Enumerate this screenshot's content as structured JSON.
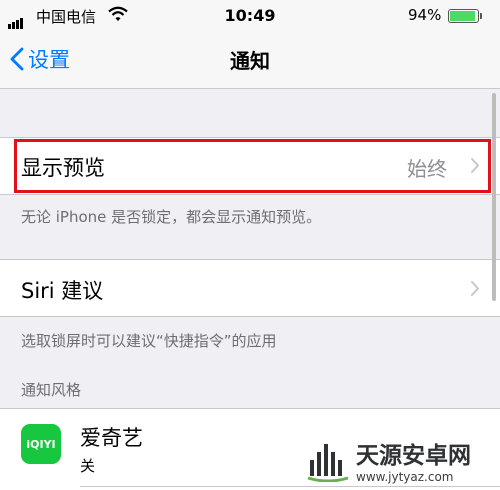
{
  "status_bar": {
    "carrier": "中国电信",
    "time": "10:49",
    "battery_percent": "94%",
    "battery_level": 0.94,
    "icons": [
      "signal-icon",
      "wifi-icon",
      "battery-icon"
    ]
  },
  "nav": {
    "back_label": "设置",
    "title": "通知"
  },
  "preview_cell": {
    "label": "显示预览",
    "value": "始终",
    "footnote": "无论 iPhone 是否锁定，都会显示通知预览。"
  },
  "siri_cell": {
    "label": "Siri 建议",
    "footnote": "选取锁屏时可以建议“快捷指令”的应用"
  },
  "section_header": "通知风格",
  "apps": [
    {
      "name": "爱奇艺",
      "state": "关",
      "icon_text": "iQIYI"
    }
  ],
  "watermark": {
    "name": "天源安卓网",
    "url": "www.jytyaz.com"
  },
  "colors": {
    "accent": "#007aff",
    "highlight": "#e0111b",
    "background": "#efeff4",
    "app_icon": "#17c73f",
    "battery": "#4cd964"
  }
}
